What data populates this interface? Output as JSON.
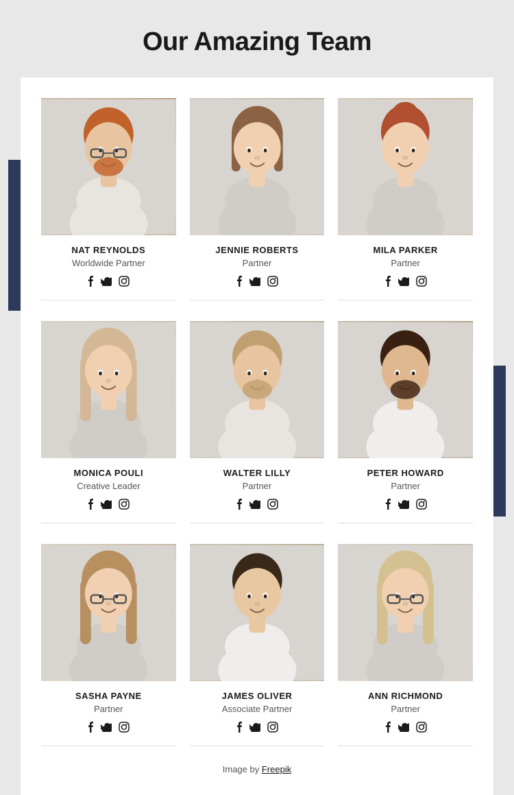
{
  "header": {
    "title": "Our Amazing Team"
  },
  "team": {
    "members": [
      {
        "id": "nat-reynolds",
        "name": "NAT REYNOLDS",
        "role": "Worldwide Partner",
        "photo_class": "photo-nat",
        "hair_color": "#c0622a",
        "skin_color": "#e8c5a0",
        "has_beard": true,
        "has_glasses": true
      },
      {
        "id": "jennie-roberts",
        "name": "JENNIE ROBERTS",
        "role": "Partner",
        "photo_class": "photo-jennie",
        "hair_color": "#8b6344",
        "skin_color": "#f0d0b0",
        "has_beard": false,
        "has_glasses": false
      },
      {
        "id": "mila-parker",
        "name": "MILA PARKER",
        "role": "Partner",
        "photo_class": "photo-mila",
        "hair_color": "#b05030",
        "skin_color": "#f0d0b0",
        "has_beard": false,
        "has_glasses": false
      },
      {
        "id": "monica-pouli",
        "name": "MONICA POULI",
        "role": "Creative Leader",
        "photo_class": "photo-monica",
        "hair_color": "#d4b896",
        "skin_color": "#f0d0b0",
        "has_beard": false,
        "has_glasses": false
      },
      {
        "id": "walter-lilly",
        "name": "WALTER LILLY",
        "role": "Partner",
        "photo_class": "photo-walter",
        "hair_color": "#c0a070",
        "skin_color": "#e8c5a0",
        "has_beard": true,
        "has_glasses": false
      },
      {
        "id": "peter-howard",
        "name": "PETER HOWARD",
        "role": "Partner",
        "photo_class": "photo-peter",
        "hair_color": "#3a2010",
        "skin_color": "#e0b890",
        "has_beard": true,
        "has_glasses": false
      },
      {
        "id": "sasha-payne",
        "name": "SASHA PAYNE",
        "role": "Partner",
        "photo_class": "photo-sasha",
        "hair_color": "#b89060",
        "skin_color": "#f0d0b0",
        "has_beard": false,
        "has_glasses": true
      },
      {
        "id": "james-oliver",
        "name": "JAMES OLIVER",
        "role": "Associate Partner",
        "photo_class": "photo-james",
        "hair_color": "#3a2818",
        "skin_color": "#e8c8a0",
        "has_beard": false,
        "has_glasses": false
      },
      {
        "id": "ann-richmond",
        "name": "ANN RICHMOND",
        "role": "Partner",
        "photo_class": "photo-ann",
        "hair_color": "#d4c090",
        "skin_color": "#f0d0b0",
        "has_beard": false,
        "has_glasses": true
      }
    ],
    "social_icons": [
      "f",
      "𝕏",
      "◉"
    ]
  },
  "footer": {
    "credit_text": "Image by ",
    "credit_link": "Freepik",
    "credit_url": "#"
  }
}
